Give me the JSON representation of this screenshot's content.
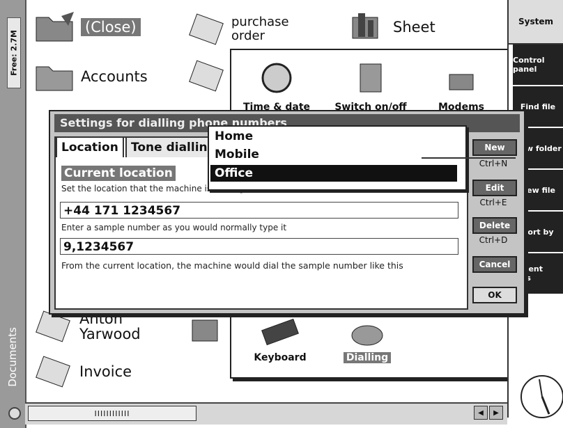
{
  "left_bar": {
    "free_space": "Free: 2.7M",
    "group_label": "Documents"
  },
  "desktop": {
    "icons": [
      {
        "label": "(Close)"
      },
      {
        "label": "Accounts"
      },
      {
        "label": "purchase order"
      },
      {
        "label": "Sheet"
      },
      {
        "label": "Anton Yarwood"
      },
      {
        "label": "Invoice"
      }
    ]
  },
  "control_panel": {
    "items": [
      {
        "label": "Time & date"
      },
      {
        "label": "Switch on/off"
      },
      {
        "label": "Modems"
      },
      {
        "label": "Keyboard"
      },
      {
        "label": "Dialling"
      }
    ]
  },
  "system_bar": {
    "title": "System",
    "buttons": [
      "Control panel",
      "Find file",
      "New folder",
      "New file",
      "Sort by",
      "Recent files"
    ]
  },
  "dialog": {
    "title": "Settings for dialling phone numbers",
    "tabs": [
      "Location",
      "Tone dialling"
    ],
    "current_location_label": "Current location",
    "current_location_help": "Set the location that the machine is dialling from",
    "phone_number": "+44 171 1234567",
    "sample_help": "Enter a sample number as you would normally type it",
    "sample_number": "9,1234567",
    "result_help": "From the current location, the machine would dial the sample number like this",
    "buttons": [
      {
        "label": "New",
        "shortcut": "Ctrl+N"
      },
      {
        "label": "Edit",
        "shortcut": "Ctrl+E"
      },
      {
        "label": "Delete",
        "shortcut": "Ctrl+D"
      },
      {
        "label": "Cancel",
        "shortcut": ""
      },
      {
        "label": "OK",
        "shortcut": ""
      }
    ]
  },
  "location_dropdown": {
    "options": [
      "Home",
      "Mobile",
      "Office"
    ],
    "selected": "Office"
  },
  "bottom_bar": {
    "scroll_label": "IIIIIIIIIIII"
  }
}
